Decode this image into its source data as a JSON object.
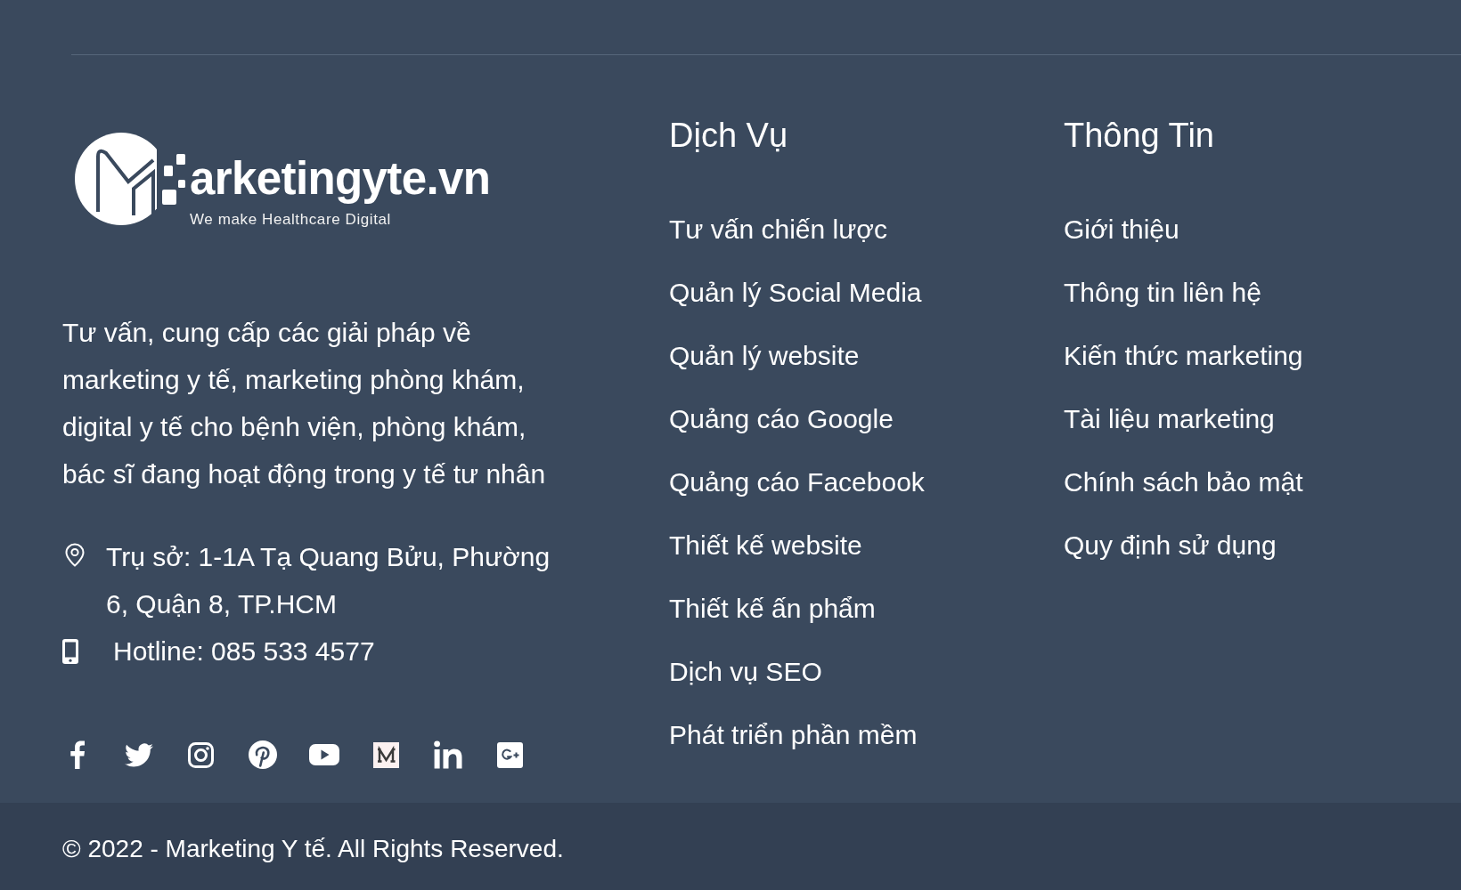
{
  "brand": {
    "wordmark": "arketingyte.vn",
    "tagline": "We make Healthcare Digital"
  },
  "about": "Tư vấn, cung cấp các giải pháp về marketing y tế, marketing phòng khám, digital y tế cho bệnh viện, phòng khám, bác sĩ đang hoạt động trong y tế tư nhân",
  "contacts": [
    {
      "kind": "address",
      "text": "Trụ sở: 1-1A Tạ Quang Bửu, Phường 6, Quận 8, TP.HCM"
    },
    {
      "kind": "phone",
      "text": "Hotline: 085 533 4577"
    }
  ],
  "columns": [
    {
      "title": "Dịch Vụ",
      "links": [
        "Tư vấn chiến lược",
        "Quản lý Social Media",
        "Quản lý website",
        "Quảng cáo Google",
        "Quảng cáo Facebook",
        "Thiết kế website",
        "Thiết kế ấn phẩm",
        "Dịch vụ SEO",
        "Phát triển phần mềm"
      ]
    },
    {
      "title": "Thông Tin",
      "links": [
        "Giới thiệu",
        "Thông tin liên hệ",
        "Kiến thức marketing",
        "Tài liệu marketing",
        "Chính sách bảo mật",
        "Quy định sử dụng"
      ]
    }
  ],
  "copyright": "© 2022 - Marketing Y tế. All Rights Reserved."
}
